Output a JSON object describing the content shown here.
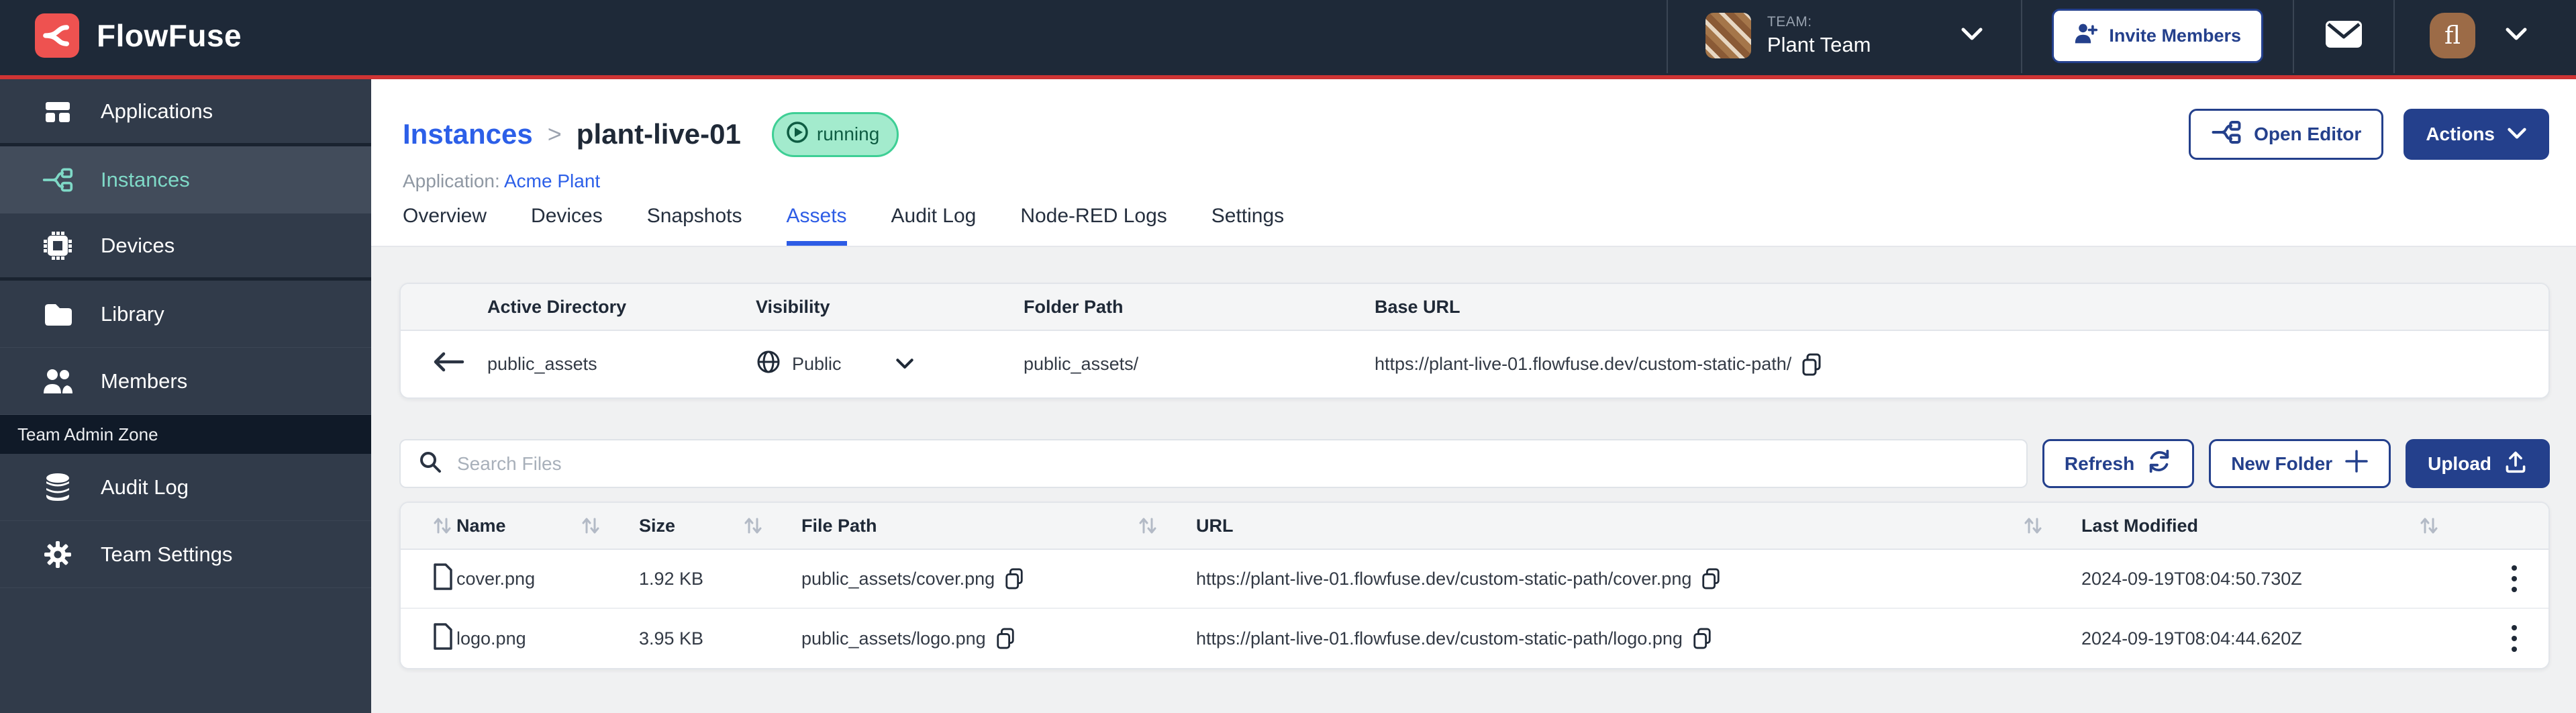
{
  "colors": {
    "topnav_bg": "#1e2938",
    "accent_red": "#ee5250",
    "red_line": "#cf3434",
    "sidebar_bg": "#313b4a",
    "sidebar_active_bg": "#424c5b",
    "sidebar_active_text": "#7fd9c7",
    "primary_blue": "#24408c",
    "link_blue": "#2c5fe8",
    "tab_active": "#2d5ce5",
    "badge_bg": "#a3ebcd",
    "badge_border": "#3ecf95",
    "badge_text": "#0e5c42",
    "content_bg": "#f0f1f2"
  },
  "topnav": {
    "brand": "FlowFuse",
    "team_label": "TEAM:",
    "team_name": "Plant Team",
    "invite_button": "Invite Members",
    "user_initials": "fl"
  },
  "sidebar": {
    "items": [
      {
        "label": "Applications"
      },
      {
        "label": "Instances"
      },
      {
        "label": "Devices"
      },
      {
        "label": "Library"
      },
      {
        "label": "Members"
      }
    ],
    "admin_zone_label": "Team Admin Zone",
    "admin_items": [
      {
        "label": "Audit Log"
      },
      {
        "label": "Team Settings"
      }
    ]
  },
  "header": {
    "breadcrumb_root": "Instances",
    "breadcrumb_sep": ">",
    "breadcrumb_current": "plant-live-01",
    "status": "running",
    "application_label": "Application:",
    "application_name": "Acme Plant",
    "open_editor_label": "Open Editor",
    "actions_label": "Actions"
  },
  "tabs": {
    "items": [
      "Overview",
      "Devices",
      "Snapshots",
      "Assets",
      "Audit Log",
      "Node-RED Logs",
      "Settings"
    ],
    "active": "Assets"
  },
  "directory": {
    "headers": [
      "Active Directory",
      "Visibility",
      "Folder Path",
      "Base URL"
    ],
    "row": {
      "name": "public_assets",
      "visibility": "Public",
      "folder_path": "public_assets/",
      "base_url": "https://plant-live-01.flowfuse.dev/custom-static-path/"
    }
  },
  "toolbar": {
    "search_placeholder": "Search Files",
    "refresh_label": "Refresh",
    "new_folder_label": "New Folder",
    "upload_label": "Upload"
  },
  "files": {
    "headers": [
      "Name",
      "Size",
      "File Path",
      "URL",
      "Last Modified"
    ],
    "rows": [
      {
        "name": "cover.png",
        "size": "1.92 KB",
        "path": "public_assets/cover.png",
        "url": "https://plant-live-01.flowfuse.dev/custom-static-path/cover.png",
        "modified": "2024-09-19T08:04:50.730Z"
      },
      {
        "name": "logo.png",
        "size": "3.95 KB",
        "path": "public_assets/logo.png",
        "url": "https://plant-live-01.flowfuse.dev/custom-static-path/logo.png",
        "modified": "2024-09-19T08:04:44.620Z"
      }
    ]
  }
}
